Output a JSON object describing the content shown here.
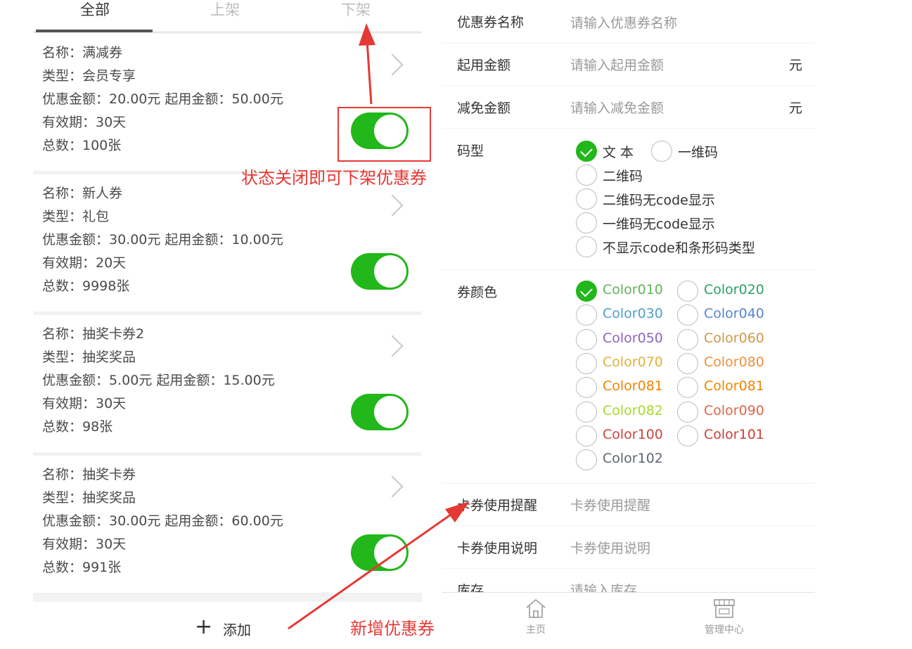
{
  "tabs": [
    "全部",
    "上架",
    "下架"
  ],
  "coupons": [
    {
      "name": "名称：满减券",
      "type": "类型：会员专享",
      "amount": "优惠金额：20.00元 起用金额：50.00元",
      "validity": "有效期：30天",
      "total": "总数：100张",
      "enabled": true
    },
    {
      "name": "名称：新人券",
      "type": "类型：礼包",
      "amount": "优惠金额：30.00元 起用金额：10.00元",
      "validity": "有效期：20天",
      "total": "总数：9998张",
      "enabled": true
    },
    {
      "name": "名称：抽奖卡券2",
      "type": "类型：抽奖奖品",
      "amount": "优惠金额：5.00元 起用金额：15.00元",
      "validity": "有效期：30天",
      "total": "总数：98张",
      "enabled": true
    },
    {
      "name": "名称：抽奖卡券",
      "type": "类型：抽奖奖品",
      "amount": "优惠金额：30.00元 起用金额：60.00元",
      "validity": "有效期：30天",
      "total": "总数：991张",
      "enabled": true
    }
  ],
  "add": {
    "plus": "+",
    "label": "添加"
  },
  "form": {
    "name_label": "优惠券名称",
    "name_placeholder": "请输入优惠券名称",
    "start_label": "起用金额",
    "start_placeholder": "请输入起用金额",
    "start_unit": "元",
    "reduce_label": "减免金额",
    "reduce_placeholder": "请输入减免金额",
    "reduce_unit": "元",
    "code_label": "码型",
    "code_options": [
      "文 本",
      "一维码",
      "二维码",
      "二维码无code显示",
      "一维码无code显示",
      "不显示code和条形码类型"
    ],
    "code_selected": "文 本",
    "color_label": "券颜色",
    "color_options": [
      {
        "name": "Color010",
        "color": "#63b359"
      },
      {
        "name": "Color020",
        "color": "#2c9f67"
      },
      {
        "name": "Color030",
        "color": "#509fc9"
      },
      {
        "name": "Color040",
        "color": "#5885cf"
      },
      {
        "name": "Color050",
        "color": "#9062c0"
      },
      {
        "name": "Color060",
        "color": "#d09a45"
      },
      {
        "name": "Color070",
        "color": "#e4b138"
      },
      {
        "name": "Color080",
        "color": "#ee903c"
      },
      {
        "name": "Color081",
        "color": "#f08500"
      },
      {
        "name": "Color081",
        "color": "#f08500"
      },
      {
        "name": "Color082",
        "color": "#a9d92d"
      },
      {
        "name": "Color090",
        "color": "#dd6549"
      },
      {
        "name": "Color100",
        "color": "#cc463d"
      },
      {
        "name": "Color101",
        "color": "#cf3e36"
      },
      {
        "name": "Color102",
        "color": "#5e6671"
      }
    ],
    "color_selected": "Color010",
    "remind_label": "卡券使用提醒",
    "remind_placeholder": "卡券使用提醒",
    "desc_label": "卡券使用说明",
    "desc_placeholder": "卡券使用说明",
    "stock_label": "库存",
    "stock_placeholder": "请输入库存"
  },
  "nav": {
    "home": "主页",
    "manage": "管理中心"
  },
  "annotations": {
    "toggle_note": "状态关闭即可下架优惠券",
    "add_note": "新增优惠券",
    "accent": "#e53935"
  },
  "icons": {
    "chevron": "chevron-right-icon",
    "home": "home-icon",
    "manage": "store-icon",
    "check": "check-icon"
  }
}
